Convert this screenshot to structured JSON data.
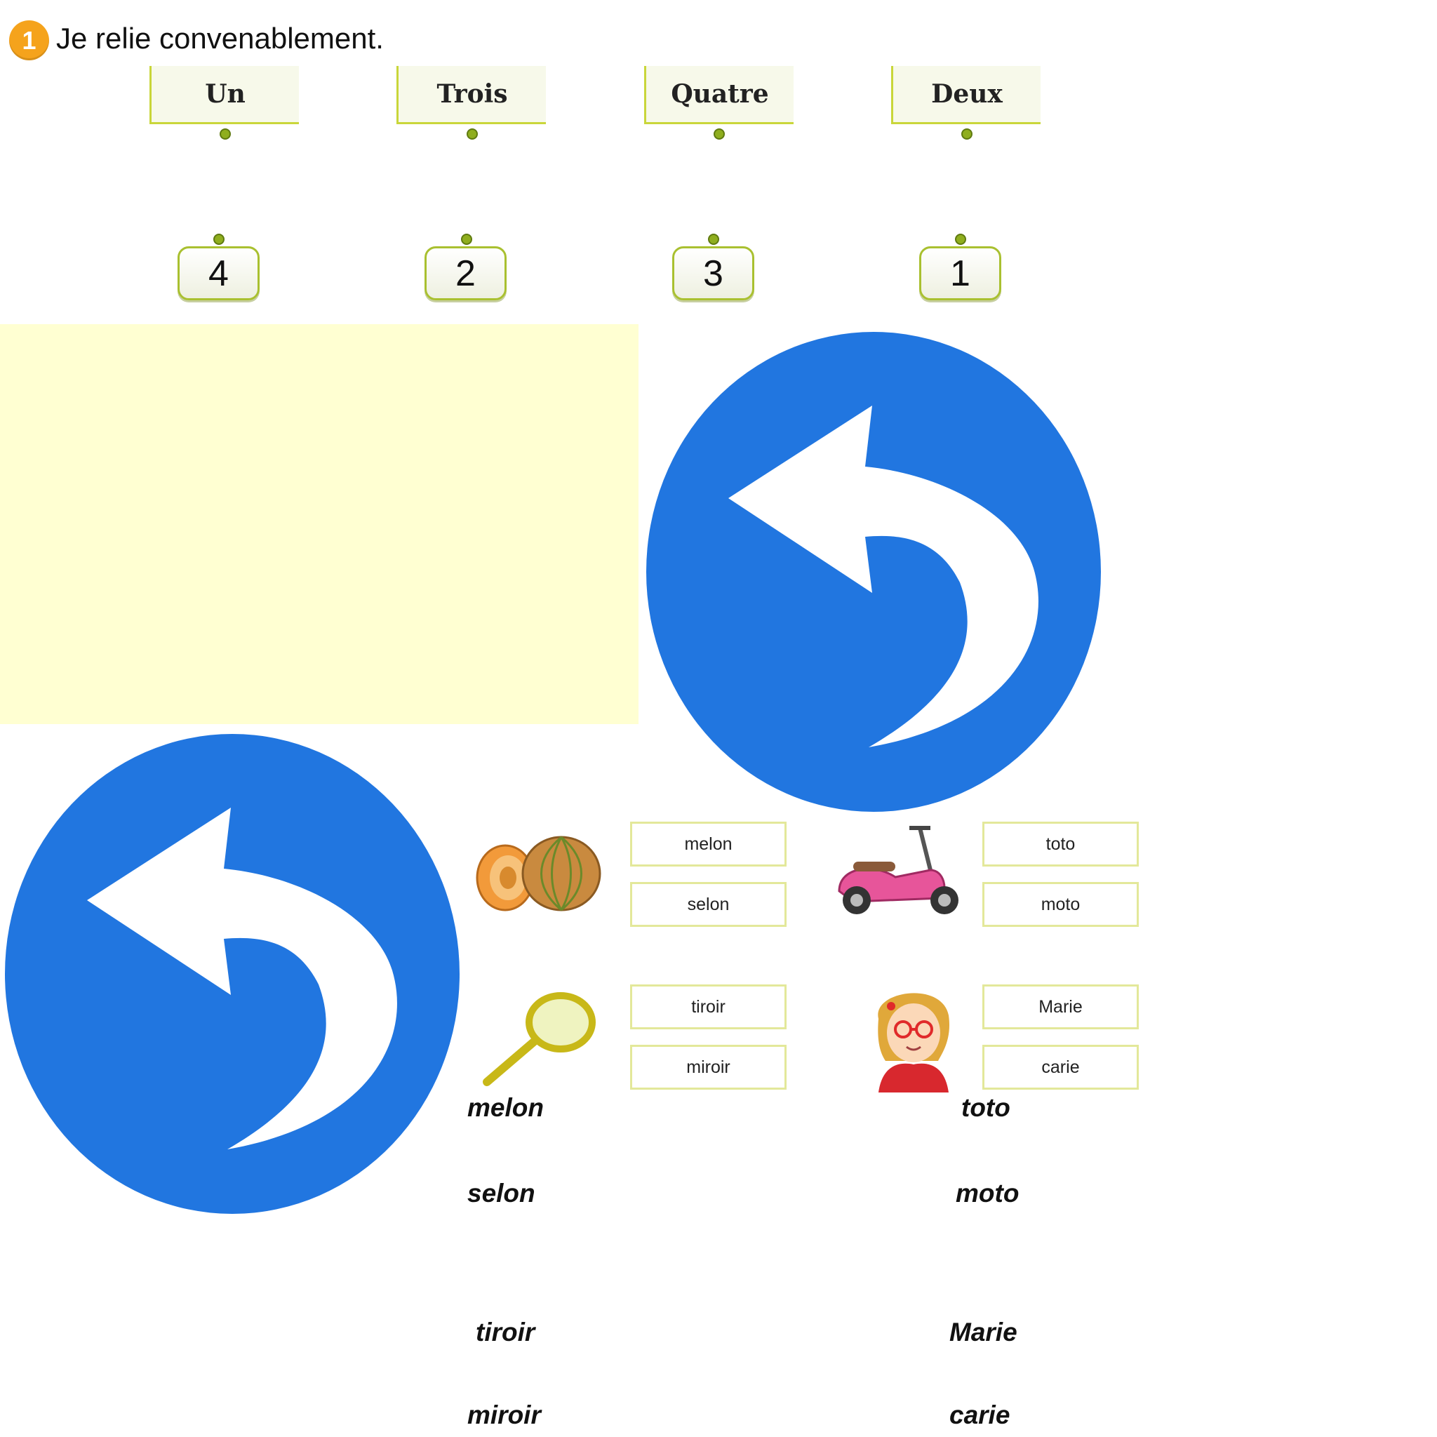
{
  "header": {
    "exercise_number": "1",
    "instruction": "Je relie convenablement."
  },
  "word_labels": [
    "Un",
    "Trois",
    "Quatre",
    "Deux"
  ],
  "number_buttons": [
    "4",
    "2",
    "3",
    "1"
  ],
  "icons": {
    "back_icon_large": "back-arrow-icon",
    "back_icon_small": "back-arrow-icon",
    "melon": "melon-image",
    "scooter": "scooter-image",
    "mirror": "mirror-image",
    "girl": "girl-image"
  },
  "colors": {
    "accent_orange": "#f5a31c",
    "label_green": "#c9d63a",
    "panel_yellow": "#ffffd2",
    "icon_blue": "#2176e0"
  },
  "choices": {
    "melon": [
      "melon",
      "selon"
    ],
    "scooter": [
      "toto",
      "moto"
    ],
    "mirror": [
      "tiroir",
      "miroir"
    ],
    "girl": [
      "Marie",
      "carie"
    ]
  },
  "answers": {
    "left": [
      "melon",
      "selon",
      "tiroir",
      "miroir"
    ],
    "right": [
      "toto",
      "moto",
      "Marie",
      "carie"
    ]
  }
}
